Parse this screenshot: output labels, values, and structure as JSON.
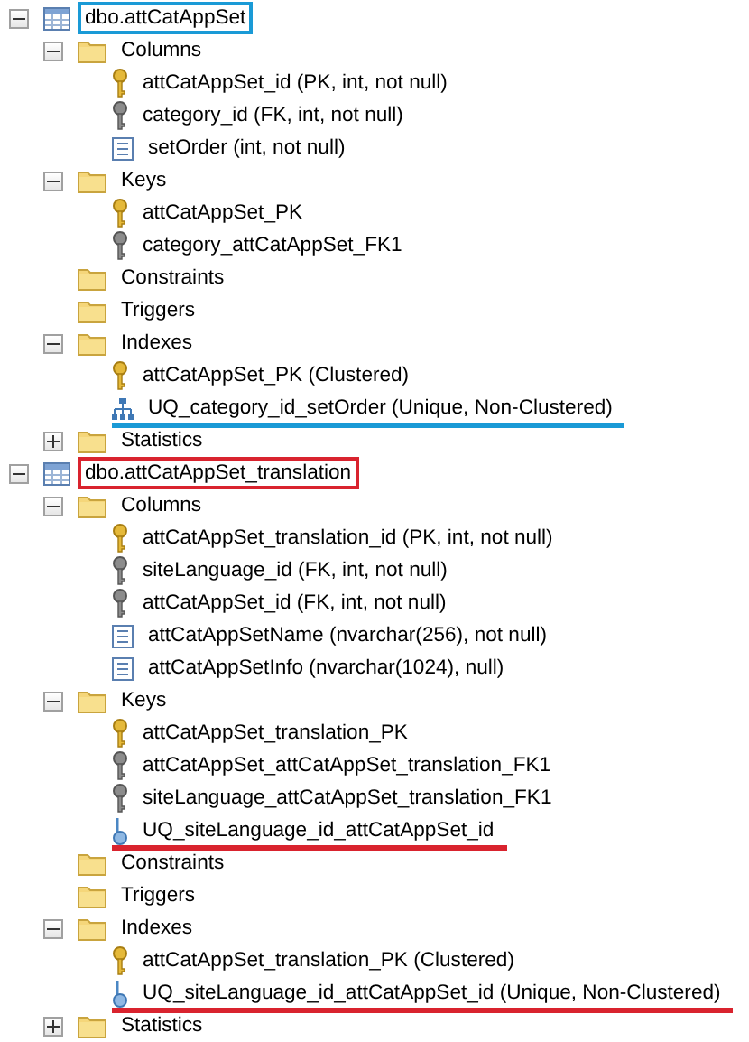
{
  "tree": [
    {
      "label": "dbo.attCatAppSet",
      "kind": "table",
      "expanded": true,
      "annotation": {
        "kind": "box",
        "color": "#1a9ad6"
      },
      "children": [
        {
          "label": "Columns",
          "kind": "folder",
          "expanded": true,
          "children": [
            {
              "label": "attCatAppSet_id (PK, int, not null)",
              "kind": "primary-key"
            },
            {
              "label": "category_id (FK, int, not null)",
              "kind": "foreign-key"
            },
            {
              "label": "setOrder (int, not null)",
              "kind": "column"
            }
          ]
        },
        {
          "label": "Keys",
          "kind": "folder",
          "expanded": true,
          "children": [
            {
              "label": "attCatAppSet_PK",
              "kind": "primary-key"
            },
            {
              "label": "category_attCatAppSet_FK1",
              "kind": "foreign-key"
            }
          ]
        },
        {
          "label": "Constraints",
          "kind": "folder"
        },
        {
          "label": "Triggers",
          "kind": "folder"
        },
        {
          "label": "Indexes",
          "kind": "folder",
          "expanded": true,
          "children": [
            {
              "label": "attCatAppSet_PK (Clustered)",
              "kind": "primary-key"
            },
            {
              "label": "UQ_category_id_setOrder (Unique, Non-Clustered)",
              "kind": "index",
              "annotation": {
                "kind": "underline",
                "color": "#1a9ad6"
              }
            }
          ]
        },
        {
          "label": "Statistics",
          "kind": "folder",
          "expanded": false
        }
      ]
    },
    {
      "label": "dbo.attCatAppSet_translation",
      "kind": "table",
      "expanded": true,
      "annotation": {
        "kind": "box",
        "color": "#d9232e"
      },
      "children": [
        {
          "label": "Columns",
          "kind": "folder",
          "expanded": true,
          "children": [
            {
              "label": "attCatAppSet_translation_id (PK, int, not null)",
              "kind": "primary-key"
            },
            {
              "label": "siteLanguage_id (FK, int, not null)",
              "kind": "foreign-key"
            },
            {
              "label": "attCatAppSet_id (FK, int, not null)",
              "kind": "foreign-key"
            },
            {
              "label": "attCatAppSetName (nvarchar(256), not null)",
              "kind": "column"
            },
            {
              "label": "attCatAppSetInfo (nvarchar(1024), null)",
              "kind": "column"
            }
          ]
        },
        {
          "label": "Keys",
          "kind": "folder",
          "expanded": true,
          "children": [
            {
              "label": "attCatAppSet_translation_PK",
              "kind": "primary-key"
            },
            {
              "label": "attCatAppSet_attCatAppSet_translation_FK1",
              "kind": "foreign-key"
            },
            {
              "label": "siteLanguage_attCatAppSet_translation_FK1",
              "kind": "foreign-key"
            },
            {
              "label": "UQ_siteLanguage_id_attCatAppSet_id",
              "kind": "unique-key",
              "annotation": {
                "kind": "underline",
                "color": "#d9232e"
              }
            }
          ]
        },
        {
          "label": "Constraints",
          "kind": "folder"
        },
        {
          "label": "Triggers",
          "kind": "folder"
        },
        {
          "label": "Indexes",
          "kind": "folder",
          "expanded": true,
          "children": [
            {
              "label": "attCatAppSet_translation_PK (Clustered)",
              "kind": "primary-key"
            },
            {
              "label": "UQ_siteLanguage_id_attCatAppSet_id (Unique, Non-Clustered)",
              "kind": "unique-key",
              "annotation": {
                "kind": "underline",
                "color": "#d9232e"
              }
            }
          ]
        },
        {
          "label": "Statistics",
          "kind": "folder",
          "expanded": false
        }
      ]
    }
  ]
}
